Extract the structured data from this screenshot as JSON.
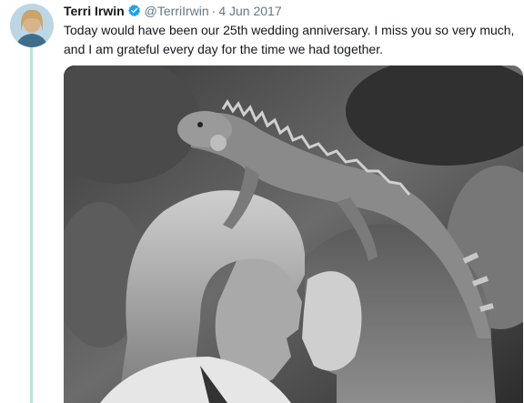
{
  "tweet": {
    "author_name": "Terri Irwin",
    "verified_icon": "verified-badge-icon",
    "handle": "@TerriIrwin",
    "separator": "·",
    "date": "4 Jun 2017",
    "text": "Today would have been our 25th wedding anniversary. I miss you so very much, and I am grateful every day for the time we had together."
  },
  "media": {
    "type": "photo",
    "style": "black-and-white"
  },
  "colors": {
    "thread_line": "#b9e6d4",
    "verified": "#1da1f2",
    "text": "#14171a",
    "secondary_text": "#657786"
  }
}
